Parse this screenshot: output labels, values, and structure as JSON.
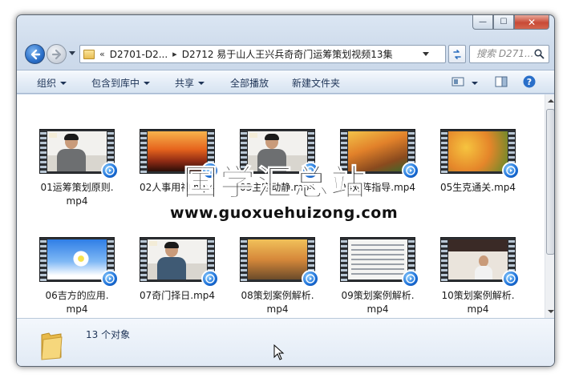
{
  "window": {
    "caption_buttons": {
      "minimize": "—",
      "maximize": "☐",
      "close": "✕"
    }
  },
  "address_bar": {
    "prefix": "«",
    "segments": [
      "D2701-D2...",
      "D2712 易于山人王兴兵奇奇门运筹策划视频13集"
    ],
    "separator": "▸",
    "dropdown_glyph": "▾"
  },
  "search": {
    "placeholder": "搜索 D271..."
  },
  "toolbar": {
    "organize": "组织",
    "include_in_library": "包含到库中",
    "share": "共享",
    "play_all": "全部播放",
    "new_folder": "新建文件夹"
  },
  "files": [
    {
      "name": "01运筹策划原则.mp4",
      "art": "person"
    },
    {
      "name": "02人事用神.mp4",
      "art": "sunset"
    },
    {
      "name": "03主客动静.mp4",
      "art": "person"
    },
    {
      "name": "04对阵指导.mp4",
      "art": "autumn"
    },
    {
      "name": "05生克通关.mp4",
      "art": "leaf"
    },
    {
      "name": "06吉方的应用.mp4",
      "art": "sky"
    },
    {
      "name": "07奇门择日.mp4",
      "art": "person"
    },
    {
      "name": "08策划案例解析.mp4",
      "art": "road"
    },
    {
      "name": "09策划案例解析.mp4",
      "art": "doc"
    },
    {
      "name": "10策划案例解析.mp4",
      "art": "room"
    }
  ],
  "file_labels": [
    [
      "01运筹策划原则.",
      "mp4"
    ],
    [
      "02人事用神.mp4",
      ""
    ],
    [
      "03主客动静.mp4",
      ""
    ],
    [
      "04对阵指导.mp4",
      ""
    ],
    [
      "05生克通关.mp4",
      ""
    ],
    [
      "06吉方的应用.",
      "mp4"
    ],
    [
      "07奇门择日.mp4",
      ""
    ],
    [
      "08策划案例解析.",
      "mp4"
    ],
    [
      "09策划案例解析.",
      "mp4"
    ],
    [
      "10策划案例解析.",
      "mp4"
    ]
  ],
  "watermark": {
    "title": "国学汇总站",
    "url": "www.guoxuehuizong.com"
  },
  "details": {
    "item_count": "13 个对象"
  },
  "colors": {
    "toolbar_text": "#1e3457",
    "accent_blue": "#2a6fc9",
    "close_red": "#c84a36"
  },
  "icons": [
    "back-arrow-icon",
    "forward-arrow-icon",
    "folder-icon",
    "refresh-icon",
    "search-icon",
    "view-options-icon",
    "preview-pane-icon",
    "help-icon",
    "media-player-badge-icon"
  ]
}
